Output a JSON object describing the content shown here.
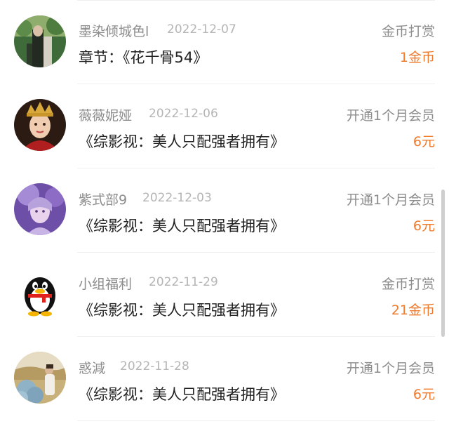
{
  "records": [
    {
      "name": "墨染倾城色l",
      "date": "2022-12-07",
      "title": "章节：《花千骨54》",
      "type": "金币打赏",
      "amount": "1金币",
      "avatar_icon": "forest-portrait-avatar"
    },
    {
      "name": "薇薇妮娅",
      "date": "2022-12-06",
      "title": "《综影视：美人只配强者拥有》",
      "type": "开通1个月会员",
      "amount": "6元",
      "avatar_icon": "crowned-lady-avatar"
    },
    {
      "name": "紫式部9",
      "date": "2022-12-03",
      "title": "《综影视：美人只配强者拥有》",
      "type": "开通1个月会员",
      "amount": "6元",
      "avatar_icon": "purple-lady-avatar"
    },
    {
      "name": "小组福利",
      "date": "2022-11-29",
      "title": "《综影视：美人只配强者拥有》",
      "type": "金币打赏",
      "amount": "21金币",
      "avatar_icon": "penguin-avatar"
    },
    {
      "name": "惑減",
      "date": "2022-11-28",
      "title": "《综影视：美人只配强者拥有》",
      "type": "开通1个月会员",
      "amount": "6元",
      "avatar_icon": "flower-field-avatar"
    }
  ],
  "colors": {
    "accent_amount": "#ee7a2b",
    "secondary_text": "#8c8c8c",
    "date_text": "#b5b5b5",
    "primary_text": "#222222"
  }
}
